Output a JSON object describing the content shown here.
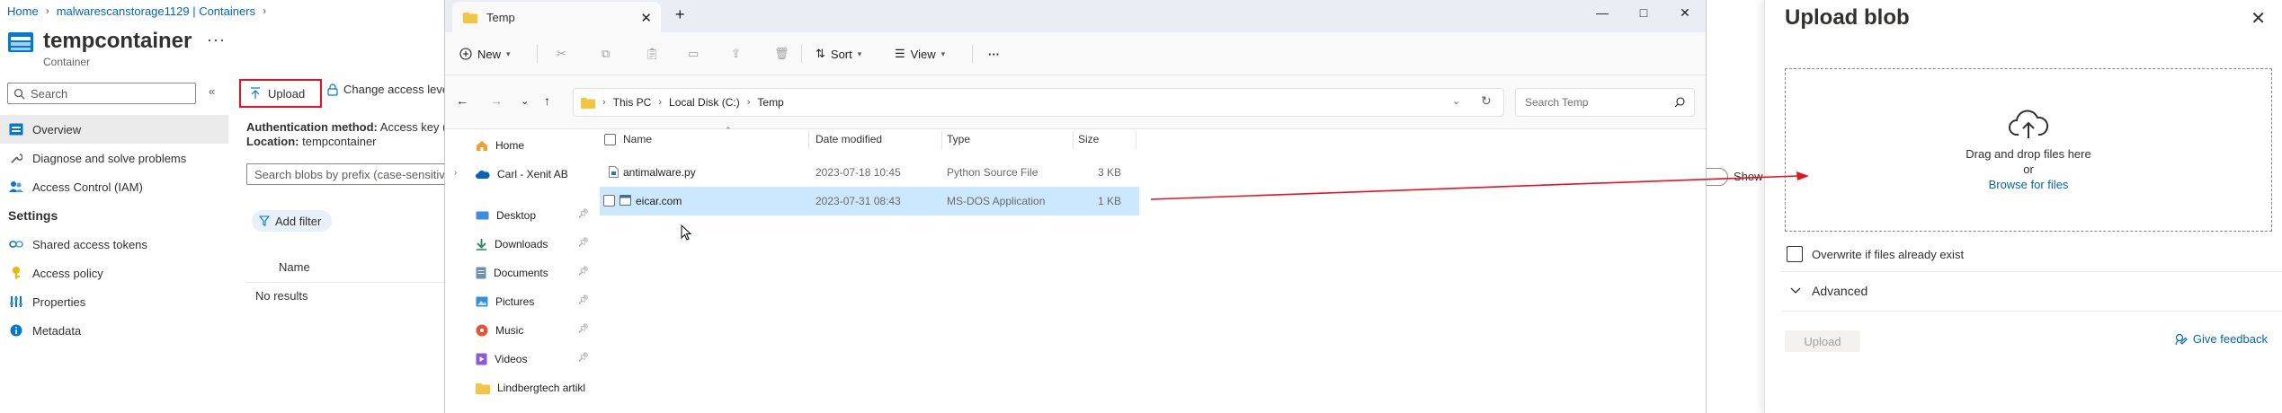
{
  "breadcrumb": [
    {
      "label": "Home"
    },
    {
      "label": "malwarescanstorage1129 | Containers"
    }
  ],
  "header": {
    "title": "tempcontainer",
    "subtitle": "Container",
    "more": "···"
  },
  "sidebar": {
    "search_placeholder": "Search",
    "collapse": "«",
    "items": [
      {
        "label": "Overview",
        "icon": "overview-icon",
        "selected": true
      },
      {
        "label": "Diagnose and solve problems",
        "icon": "wrench-icon"
      },
      {
        "label": "Access Control (IAM)",
        "icon": "people-icon"
      }
    ],
    "settings_heading": "Settings",
    "settings_items": [
      {
        "label": "Shared access tokens",
        "icon": "link-icon"
      },
      {
        "label": "Access policy",
        "icon": "key-icon"
      },
      {
        "label": "Properties",
        "icon": "properties-icon"
      },
      {
        "label": "Metadata",
        "icon": "info-icon"
      }
    ]
  },
  "commands": {
    "upload": "Upload",
    "change_access": "Change access leve"
  },
  "auth": {
    "method_label": "Authentication method:",
    "method_value": "Access key (",
    "location_label": "Location:",
    "location_value": "tempcontainer"
  },
  "blobs": {
    "search_placeholder": "Search blobs by prefix (case-sensitive",
    "add_filter": "Add filter",
    "column_name": "Name",
    "no_results": "No results",
    "show_label": "Show"
  },
  "explorer": {
    "tab_title": "Temp",
    "tab_close": "✕",
    "new_tab": "+",
    "window_controls": [
      "—",
      "□",
      "✕"
    ],
    "toolbar": {
      "new": "New",
      "sort": "Sort",
      "view": "View",
      "more": "···"
    },
    "address": [
      "This PC",
      "Local Disk (C:)",
      "Temp"
    ],
    "search_placeholder": "Search Temp",
    "nav": [
      {
        "label": "Home",
        "icon": "home-icon"
      },
      {
        "label": "Carl - Xenit AB",
        "icon": "onedrive-icon"
      },
      {
        "label": "Desktop",
        "icon": "desktop-icon",
        "pinned": true
      },
      {
        "label": "Downloads",
        "icon": "downloads-icon",
        "pinned": true
      },
      {
        "label": "Documents",
        "icon": "documents-icon",
        "pinned": true
      },
      {
        "label": "Pictures",
        "icon": "pictures-icon",
        "pinned": true
      },
      {
        "label": "Music",
        "icon": "music-icon",
        "pinned": true
      },
      {
        "label": "Videos",
        "icon": "videos-icon",
        "pinned": true
      },
      {
        "label": "Lindbergtech artikl",
        "icon": "folder-icon"
      }
    ],
    "columns": [
      "Name",
      "Date modified",
      "Type",
      "Size"
    ],
    "files": [
      {
        "name": "antimalware.py",
        "date": "2023-07-18 10:45",
        "type": "Python Source File",
        "size": "3 KB",
        "selected": false
      },
      {
        "name": "eicar.com",
        "date": "2023-07-31 08:43",
        "type": "MS-DOS Application",
        "size": "1 KB",
        "selected": true
      }
    ]
  },
  "upload_panel": {
    "title": "Upload blob",
    "close": "✕",
    "drop_text": "Drag and drop files here",
    "or": "or",
    "browse": "Browse for files",
    "overwrite": "Overwrite if files already exist",
    "advanced": "Advanced",
    "upload_button": "Upload",
    "feedback": "Give feedback"
  },
  "colors": {
    "azure_link": "#0066b8",
    "highlight_red": "#e81123",
    "selection_blue": "#cce8ff",
    "folder_yellow": "#f4c542"
  }
}
